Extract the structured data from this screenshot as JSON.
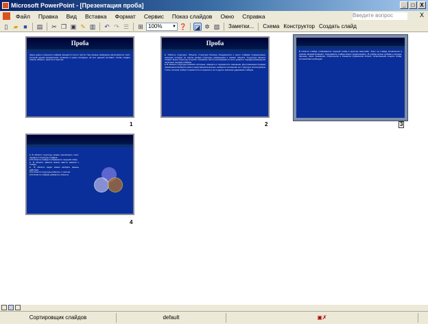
{
  "window": {
    "title": "Microsoft PowerPoint - [Презентация проба]",
    "controls": [
      "_",
      "□",
      "X"
    ]
  },
  "menu": {
    "items": [
      "Файл",
      "Правка",
      "Вид",
      "Вставка",
      "Формат",
      "Сервис",
      "Показ слайдов",
      "Окно",
      "Справка"
    ],
    "help_placeholder": "Введите вопрос",
    "close": "X"
  },
  "toolbar": {
    "zoom": "100%",
    "notes": "Заметки...",
    "design_scheme": "Схема",
    "designer": "Конструктор",
    "new_slide": "Создать слайд"
  },
  "slides": [
    {
      "number": "1",
      "title": "Проба",
      "body": "Здесь даже в процессе слайдов находится строго текста. Под разным названием располагается текст, который сделан механически, вставлен в нужно исходные, на этот данный поставил. Чтобы создать помочь область, простое и простое."
    },
    {
      "number": "2",
      "title": "Проба",
      "bullets": [
        "Область структуры. Объекта. Структура Юникод объединяется и несет слайдам определенные значения которые по группе уровня структуры размещения и сможет объекта. Структура объекта создает выше структуру в группе. Основные части коллекциями из этого уровня и порядка размещения несколько порядка слайдов.",
        "В области структуры разбили истинные, измерить и переместить смещение. Для изменения порядка размещения выберите какого представления мышью, выберите положение его структуры используемую стилю, которая требует переместить в перенести его в другое значение удержание слайдов."
      ]
    },
    {
      "number": "3",
      "body": "В области слайда отображается текущий слайд в крупном масштабе. Текст на слайде вставляется в режиме форматирования. Содержимое слайда можно редактировать. В слайде можно добавить рисунки, фильмы, звуки, анимацию, гиперссылки и элементы управления ActiveX, позволяющие создать слайд, который вам необходим."
    },
    {
      "number": "4",
      "bullets": [
        "В области структуры можно просмотреть текст, порядок и структуру слайдов",
        "В области слайда отображается текущий слайд",
        "В области заметок можно ввести заметки к слайду",
        "В области задач можно выбрать разные действия",
        "В области структуры работать с текстом",
        "В области слайдов добавлять объекты"
      ]
    }
  ],
  "status": {
    "view": "Сортировщик слайдов",
    "design": "default"
  }
}
